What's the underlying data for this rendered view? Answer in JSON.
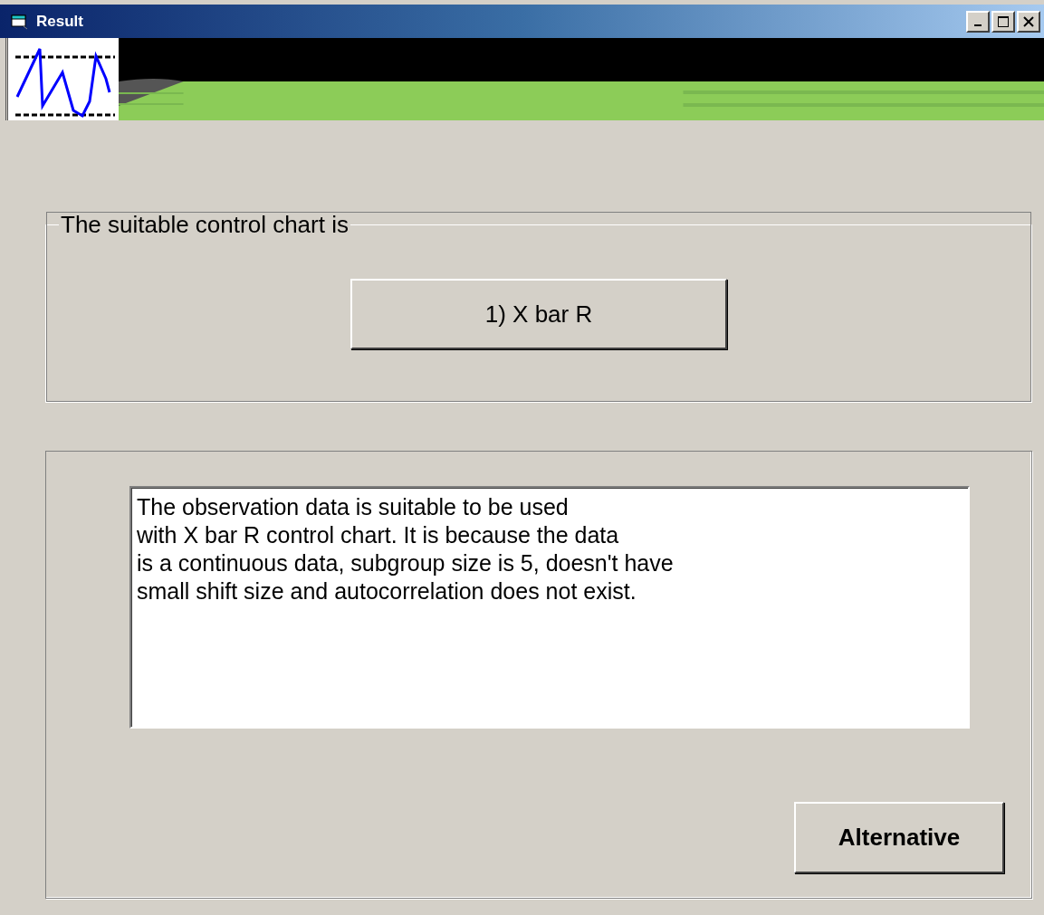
{
  "window": {
    "title": "Result"
  },
  "result_frame": {
    "legend": "The suitable control chart is",
    "chart_button": "1) X bar R"
  },
  "explanation": {
    "text": "The observation data is suitable to be used\nwith X bar R control chart. It is because the data\nis a continuous data, subgroup size is 5, doesn't have\nsmall shift size and autocorrelation does not exist."
  },
  "buttons": [
    {
      "label": "Alternative"
    }
  ]
}
